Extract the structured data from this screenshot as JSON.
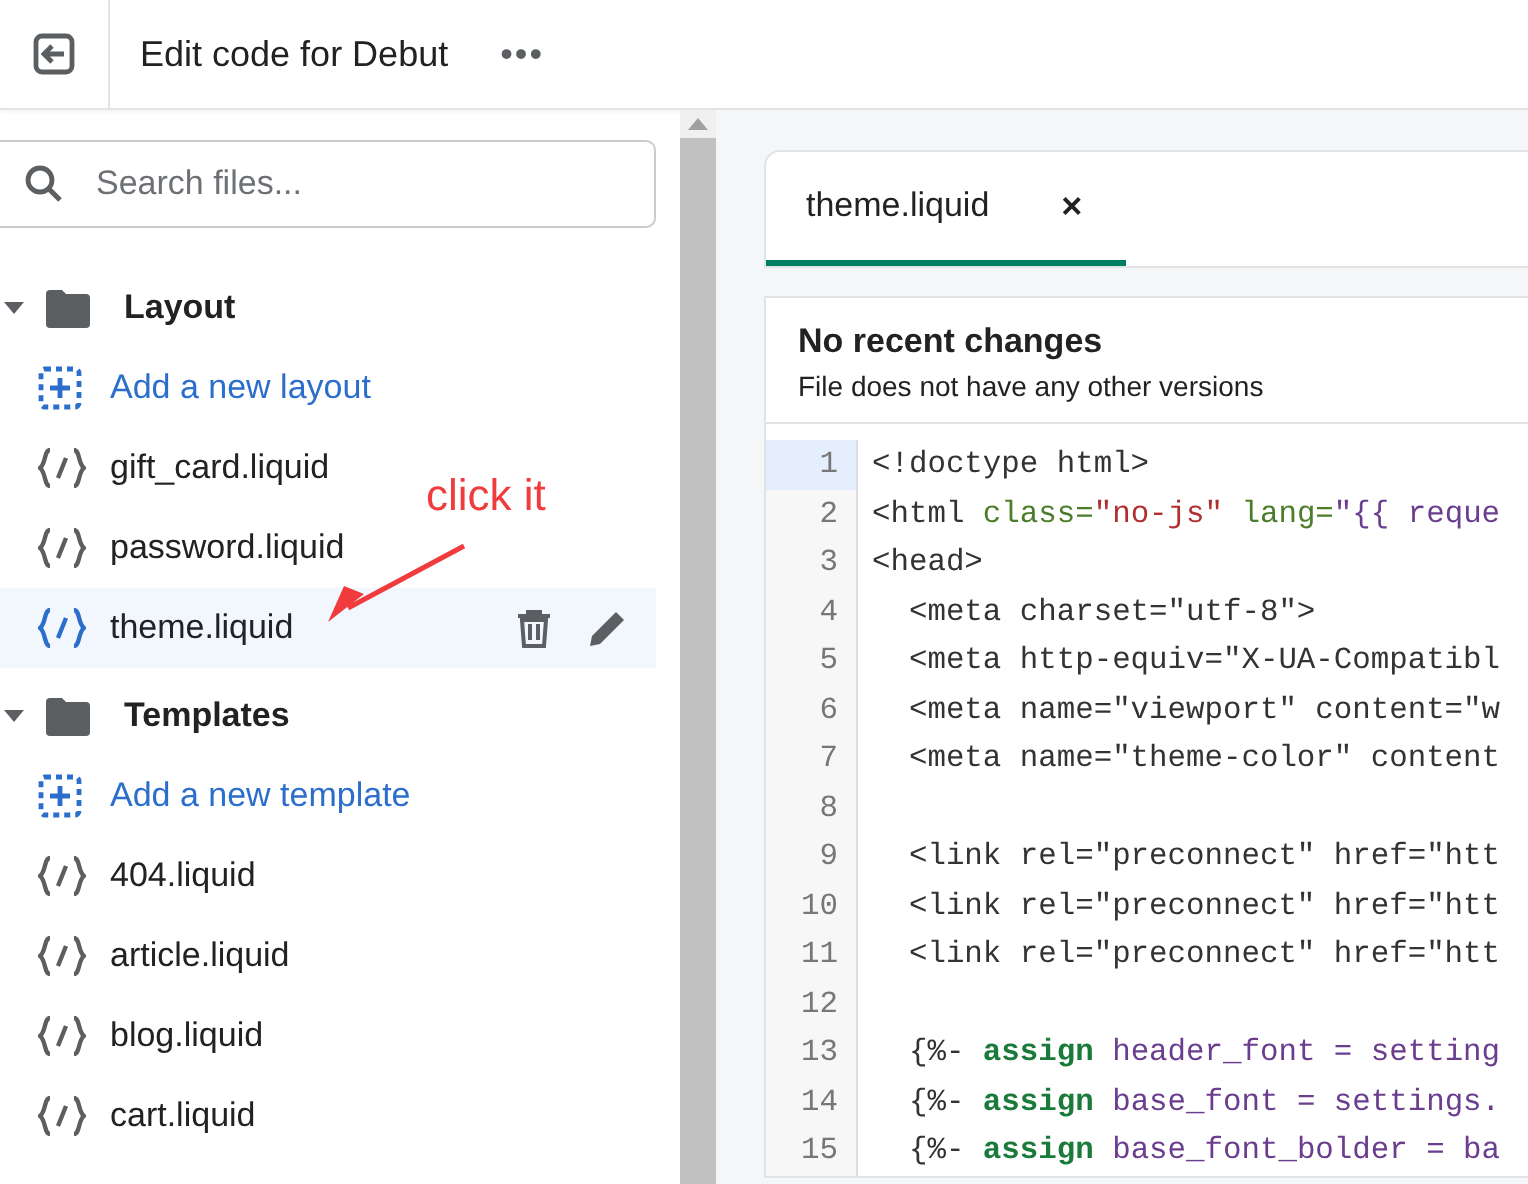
{
  "header": {
    "title": "Edit code for Debut",
    "more": "•••"
  },
  "search": {
    "placeholder": "Search files..."
  },
  "sidebar": {
    "folders": [
      {
        "name": "Layout",
        "expanded": true,
        "add_label": "Add a new layout",
        "files": [
          {
            "name": "gift_card.liquid",
            "selected": false
          },
          {
            "name": "password.liquid",
            "selected": false
          },
          {
            "name": "theme.liquid",
            "selected": true
          }
        ]
      },
      {
        "name": "Templates",
        "expanded": true,
        "add_label": "Add a new template",
        "files": [
          {
            "name": "404.liquid",
            "selected": false
          },
          {
            "name": "article.liquid",
            "selected": false
          },
          {
            "name": "blog.liquid",
            "selected": false
          },
          {
            "name": "cart.liquid",
            "selected": false
          }
        ]
      }
    ]
  },
  "annotation": {
    "text": "click it"
  },
  "tabs": [
    {
      "label": "theme.liquid",
      "close": "×",
      "selected": true
    }
  ],
  "history": {
    "title": "No recent changes",
    "subtitle": "File does not have any other versions"
  },
  "code": {
    "lines": [
      {
        "number": "1",
        "current": true,
        "tokens": [
          {
            "kind": "plain",
            "text": "<!doctype html>"
          }
        ]
      },
      {
        "number": "2",
        "current": false,
        "tokens": [
          {
            "kind": "plain",
            "text": "<html "
          },
          {
            "kind": "attr",
            "text": "class="
          },
          {
            "kind": "string",
            "text": "\"no-js\""
          },
          {
            "kind": "attr",
            "text": " lang="
          },
          {
            "kind": "liquid",
            "text": "\"{{ reque"
          }
        ]
      },
      {
        "number": "3",
        "current": false,
        "tokens": [
          {
            "kind": "plain",
            "text": "<head>"
          }
        ]
      },
      {
        "number": "4",
        "current": false,
        "tokens": [
          {
            "kind": "plain",
            "text": "  <meta charset=\"utf-8\">"
          }
        ]
      },
      {
        "number": "5",
        "current": false,
        "tokens": [
          {
            "kind": "plain",
            "text": "  <meta http-equiv=\"X-UA-Compatibl"
          }
        ]
      },
      {
        "number": "6",
        "current": false,
        "tokens": [
          {
            "kind": "plain",
            "text": "  <meta name=\"viewport\" content=\"w"
          }
        ]
      },
      {
        "number": "7",
        "current": false,
        "tokens": [
          {
            "kind": "plain",
            "text": "  <meta name=\"theme-color\" content"
          }
        ]
      },
      {
        "number": "8",
        "current": false
      },
      {
        "number": "9",
        "current": false,
        "tokens": [
          {
            "kind": "plain",
            "text": "  <link rel=\"preconnect\" href=\"htt"
          }
        ]
      },
      {
        "number": "10",
        "current": false,
        "tokens": [
          {
            "kind": "plain",
            "text": "  <link rel=\"preconnect\" href=\"htt"
          }
        ]
      },
      {
        "number": "11",
        "current": false,
        "tokens": [
          {
            "kind": "plain",
            "text": "  <link rel=\"preconnect\" href=\"htt"
          }
        ]
      },
      {
        "number": "12",
        "current": false
      },
      {
        "number": "13",
        "current": false,
        "tokens": [
          {
            "kind": "plain",
            "text": "  {%- "
          },
          {
            "kind": "keyword",
            "text": "assign"
          },
          {
            "kind": "liquid",
            "text": " header_font = setting"
          }
        ]
      },
      {
        "number": "14",
        "current": false,
        "tokens": [
          {
            "kind": "plain",
            "text": "  {%- "
          },
          {
            "kind": "keyword",
            "text": "assign"
          },
          {
            "kind": "liquid",
            "text": " base_font = settings."
          }
        ]
      },
      {
        "number": "15",
        "current": false,
        "tokens": [
          {
            "kind": "plain",
            "text": "  {%- "
          },
          {
            "kind": "keyword",
            "text": "assign"
          },
          {
            "kind": "liquid",
            "text": " base_font_bolder = ba"
          }
        ]
      }
    ]
  }
}
